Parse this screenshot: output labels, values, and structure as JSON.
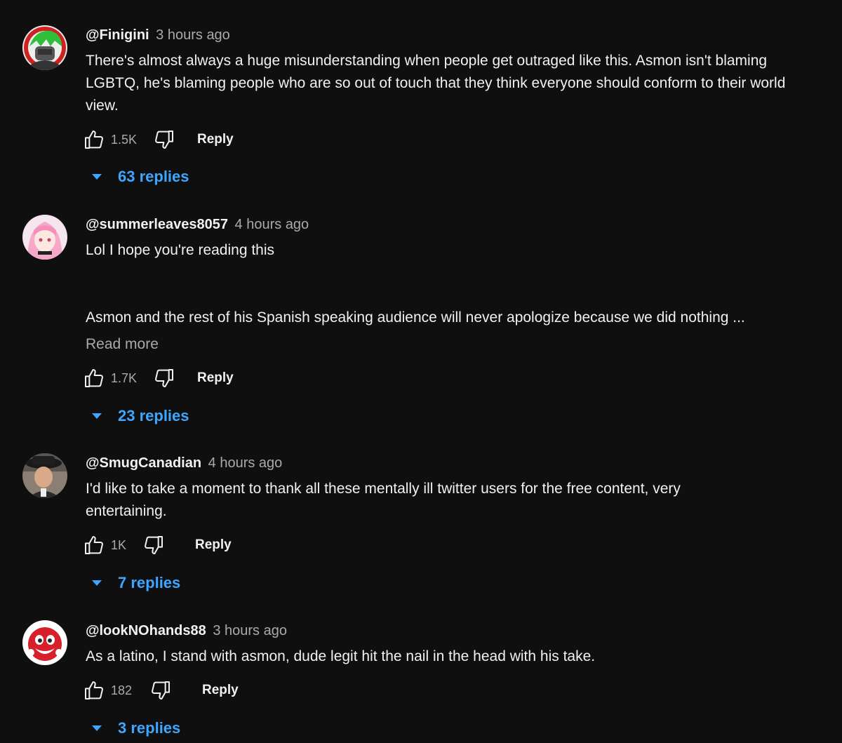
{
  "comments": [
    {
      "author": "@Finigini",
      "time": "3 hours ago",
      "text": "There's almost always a huge misunderstanding when people get outraged like this. Asmon isn't blaming LGBTQ, he's blaming people who are so out of touch that they think everyone should conform to their world view.",
      "likes": "1.5K",
      "reply_label": "Reply",
      "replies_label": "63 replies",
      "avatar_icon": "green-hair-avatar-icon"
    },
    {
      "author": "@summerleaves8057",
      "time": "4 hours ago",
      "text_line1": "Lol I hope you're reading this",
      "text_line2": "Asmon and the rest of his Spanish speaking audience will never apologize because we did nothing ...",
      "read_more": "Read more",
      "likes": "1.7K",
      "reply_label": "Reply",
      "replies_label": "23 replies",
      "avatar_icon": "pink-hair-avatar-icon"
    },
    {
      "author": "@SmugCanadian",
      "time": "4 hours ago",
      "text": "I'd like to take a moment to thank all these mentally ill twitter users for the free content, very entertaining.",
      "likes": "1K",
      "reply_label": "Reply",
      "replies_label": "7 replies",
      "avatar_icon": "man-with-hat-avatar-icon"
    },
    {
      "author": "@lookNOhands88",
      "time": "3 hours ago",
      "text": "As a latino, I stand with asmon, dude legit hit the nail in the head with his take.",
      "likes": "182",
      "reply_label": "Reply",
      "replies_label": "3 replies",
      "avatar_icon": "red-mascot-avatar-icon"
    }
  ],
  "colors": {
    "background": "#0f0f0f",
    "text": "#f1f1f1",
    "secondary_text": "#aaaaaa",
    "link": "#3ea6ff"
  }
}
